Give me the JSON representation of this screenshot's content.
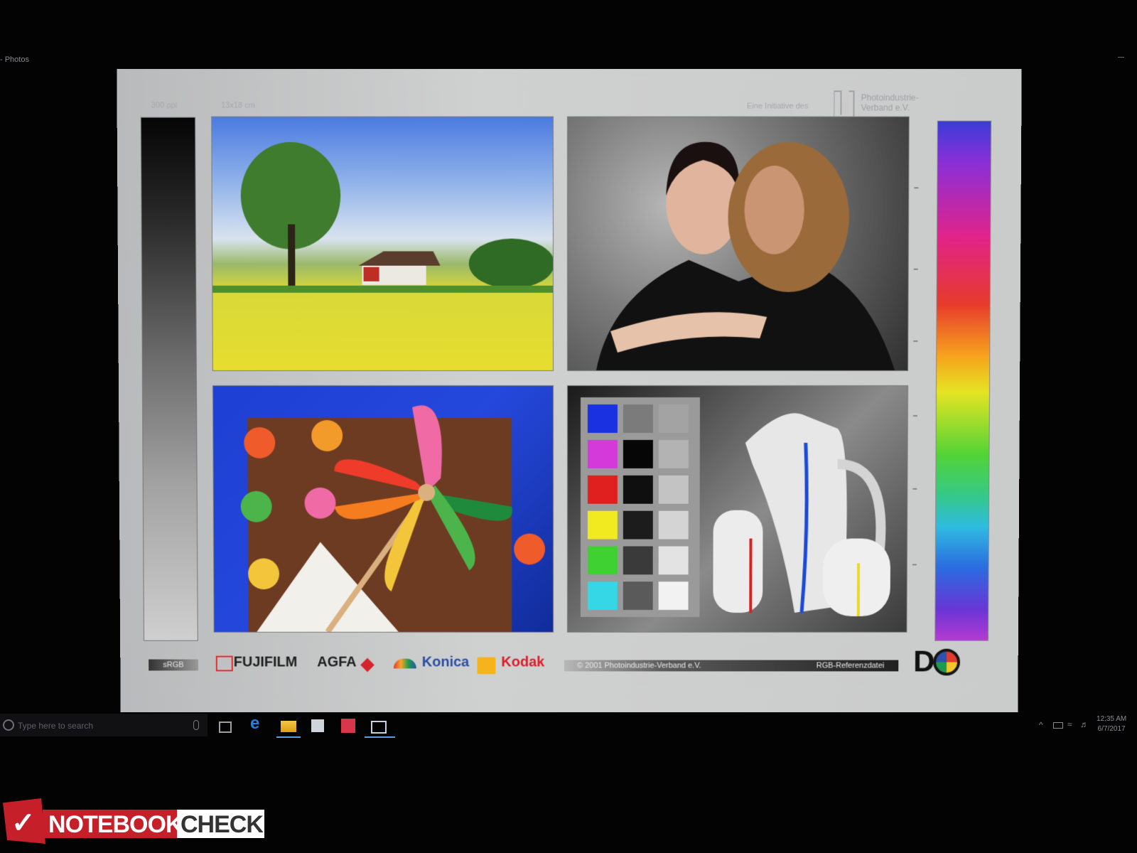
{
  "window": {
    "title": "- Photos"
  },
  "chart": {
    "top_left": {
      "ppi": "300 ppi",
      "size": "13x18 cm"
    },
    "top_right": {
      "initiative": "Eine Initiative des",
      "org_line1": "Photoindustrie-",
      "org_line2": "Verband e.V."
    },
    "bottom": {
      "color_space": "sRGB",
      "brands": [
        "FUJIFILM",
        "AGFA",
        "Konica",
        "Kodak"
      ],
      "copyright": "© 2001 Photoindustrie-Verband e.V.",
      "file_label": "RGB-Referenzdatei"
    }
  },
  "taskbar": {
    "search_placeholder": "Type here to search",
    "pinned": [
      "task-view",
      "edge",
      "file-explorer",
      "store",
      "gift",
      "photos"
    ],
    "clock": {
      "time": "12:35 AM",
      "date": "6/7/2017"
    }
  },
  "watermark": {
    "part1": "NOTEBOOK",
    "part2": "CHECK"
  }
}
